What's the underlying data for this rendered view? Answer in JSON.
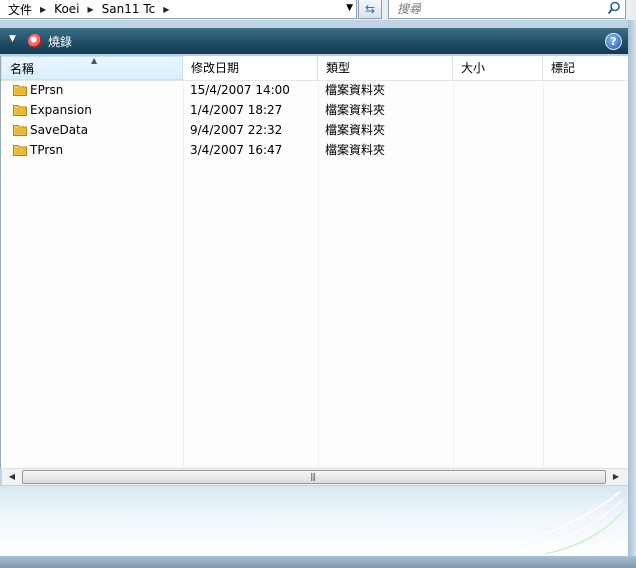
{
  "breadcrumb": [
    "文件",
    "Koei",
    "San11 Tc"
  ],
  "search": {
    "placeholder": "搜尋"
  },
  "toolbar": {
    "burn_label": "燒錄",
    "help": "?"
  },
  "columns": [
    "名稱",
    "修改日期",
    "類型",
    "大小",
    "標記"
  ],
  "files": [
    {
      "name": "EPrsn",
      "date": "15/4/2007 14:00",
      "type": "檔案資料夾",
      "size": "",
      "tags": ""
    },
    {
      "name": "Expansion",
      "date": "1/4/2007 18:27",
      "type": "檔案資料夾",
      "size": "",
      "tags": ""
    },
    {
      "name": "SaveData",
      "date": "9/4/2007 22:32",
      "type": "檔案資料夾",
      "size": "",
      "tags": ""
    },
    {
      "name": "TPrsn",
      "date": "3/4/2007 16:47",
      "type": "檔案資料夾",
      "size": "",
      "tags": ""
    }
  ],
  "colors": {
    "command_bar": "#1f4e66",
    "folder": "#e8b93a"
  },
  "icons": [
    "chevron-right-icon",
    "refresh-icon",
    "search-icon",
    "burn-icon",
    "help-icon",
    "folder-icon"
  ]
}
